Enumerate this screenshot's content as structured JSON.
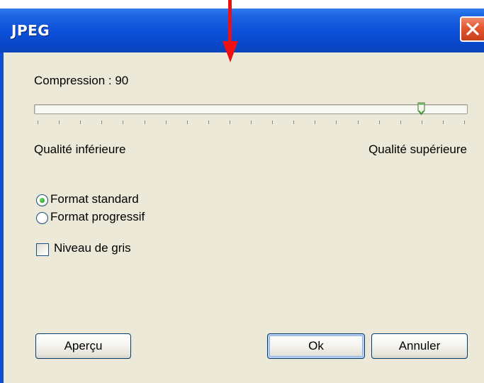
{
  "window": {
    "title": "JPEG"
  },
  "compression": {
    "label": "Compression : 90",
    "value": 90,
    "min": 0,
    "max": 100,
    "min_label": "Qualité inférieure",
    "max_label": "Qualité supérieure"
  },
  "format": {
    "options": [
      {
        "label": "Format standard",
        "selected": true
      },
      {
        "label": "Format progressif",
        "selected": false
      }
    ]
  },
  "grayscale": {
    "label": "Niveau de gris",
    "checked": false
  },
  "buttons": {
    "preview": "Aperçu",
    "ok": "Ok",
    "cancel": "Annuler"
  },
  "colors": {
    "titlebar": "#0a4fd6",
    "client": "#ece9d8",
    "close": "#e2572f",
    "annotation_arrow": "#ee1111",
    "radio_dot": "#2da42c"
  },
  "icons": {
    "close": "close-icon",
    "annotation": "red-down-arrow"
  }
}
